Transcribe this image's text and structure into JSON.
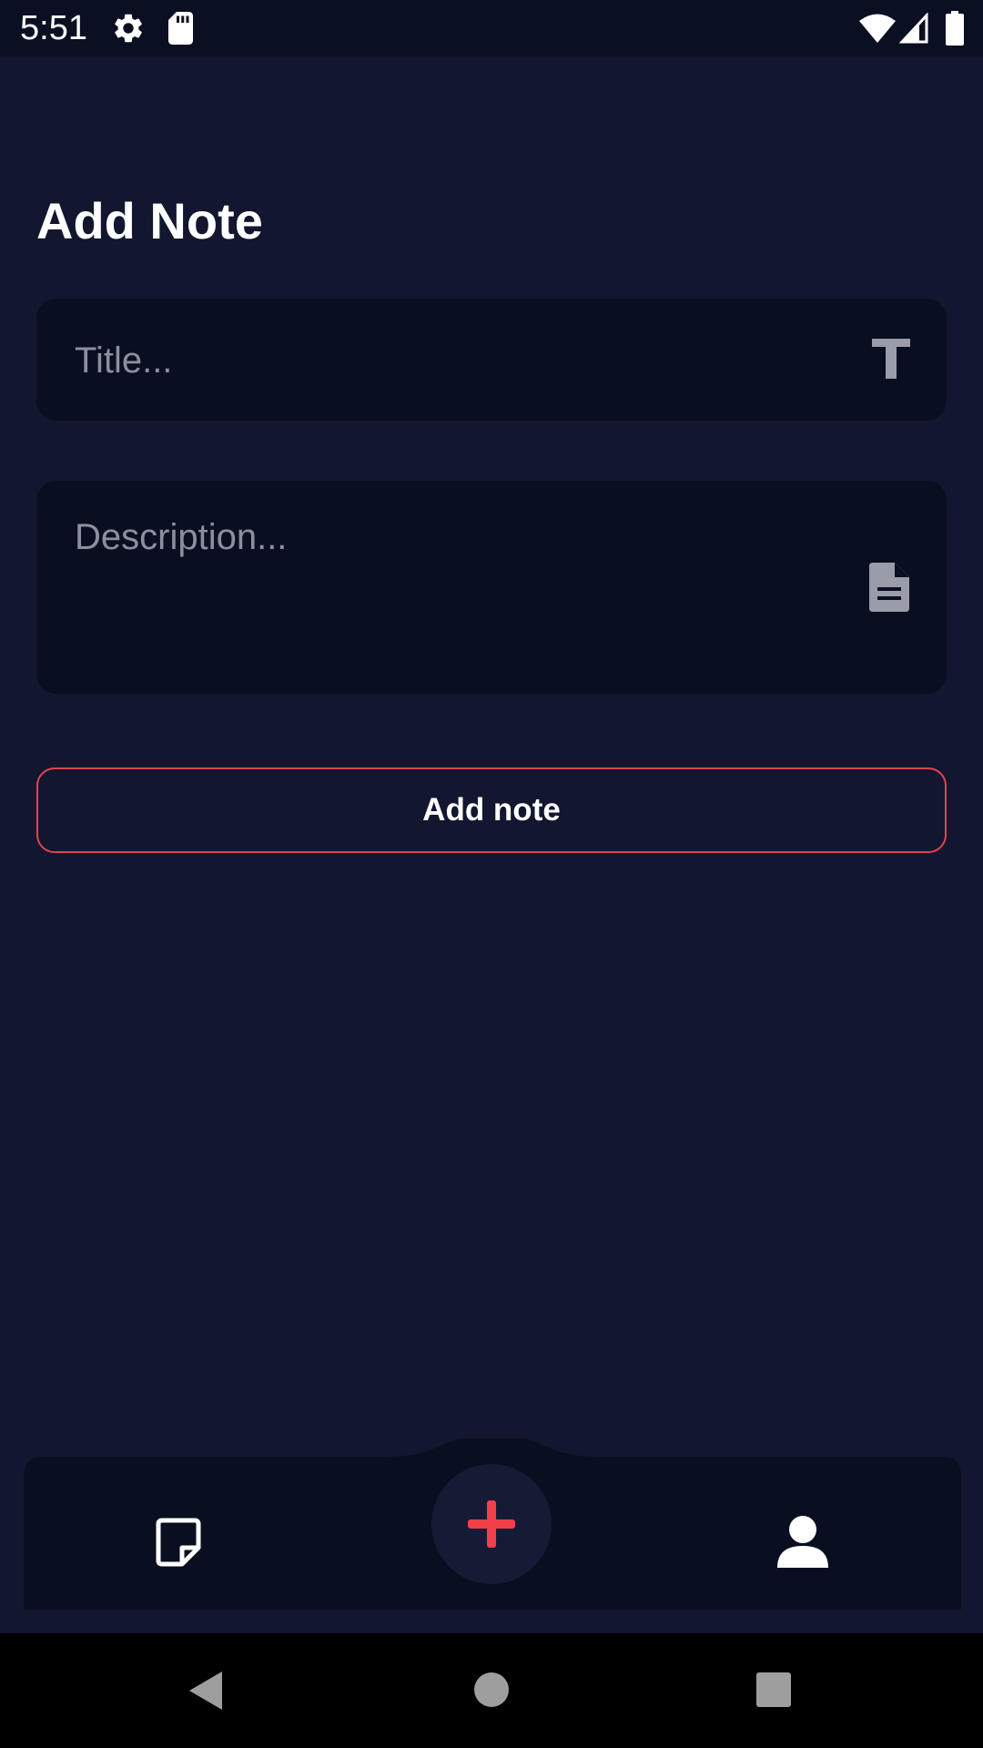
{
  "status_bar": {
    "time": "5:51",
    "icons": [
      "settings-icon",
      "sd-card-icon",
      "wifi-icon",
      "signal-icon",
      "battery-icon"
    ]
  },
  "page": {
    "title": "Add Note"
  },
  "form": {
    "title_placeholder": "Title...",
    "title_icon": "text-format-icon",
    "description_placeholder": "Description...",
    "description_icon": "document-icon",
    "submit_label": "Add note"
  },
  "bottom_nav": {
    "items": [
      {
        "icon": "sticky-note-icon"
      },
      {
        "icon": "plus-icon"
      },
      {
        "icon": "person-icon"
      }
    ]
  },
  "system_nav": {
    "icons": [
      "back-icon",
      "home-icon",
      "recents-icon"
    ]
  },
  "colors": {
    "background": "#12162f",
    "surface": "#0a0e21",
    "accent": "#e0444f",
    "text": "#ffffff",
    "placeholder": "#8c8f9e"
  }
}
